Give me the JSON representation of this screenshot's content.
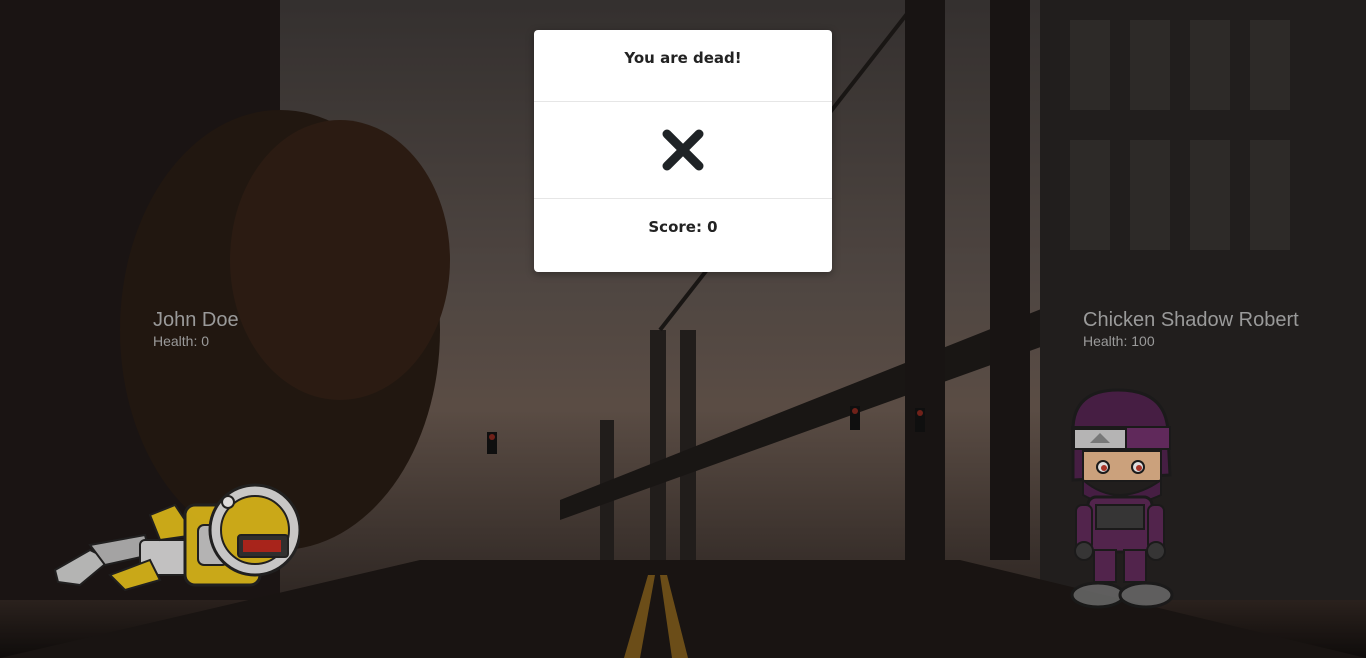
{
  "modal": {
    "title": "You are dead!",
    "icon": "close-icon",
    "score_text": "Score: 0"
  },
  "players": {
    "left": {
      "name": "John Doe",
      "health_text": "Health: 0",
      "sprite": "robot-sprite"
    },
    "right": {
      "name": "Chicken Shadow Robert",
      "health_text": "Health: 100",
      "sprite": "ninja-sprite"
    }
  },
  "colors": {
    "modal_bg": "#ffffff",
    "overlay": "rgba(0,0,0,0.42)",
    "player_text": "#9a9a9a",
    "icon": "#1f2326"
  }
}
